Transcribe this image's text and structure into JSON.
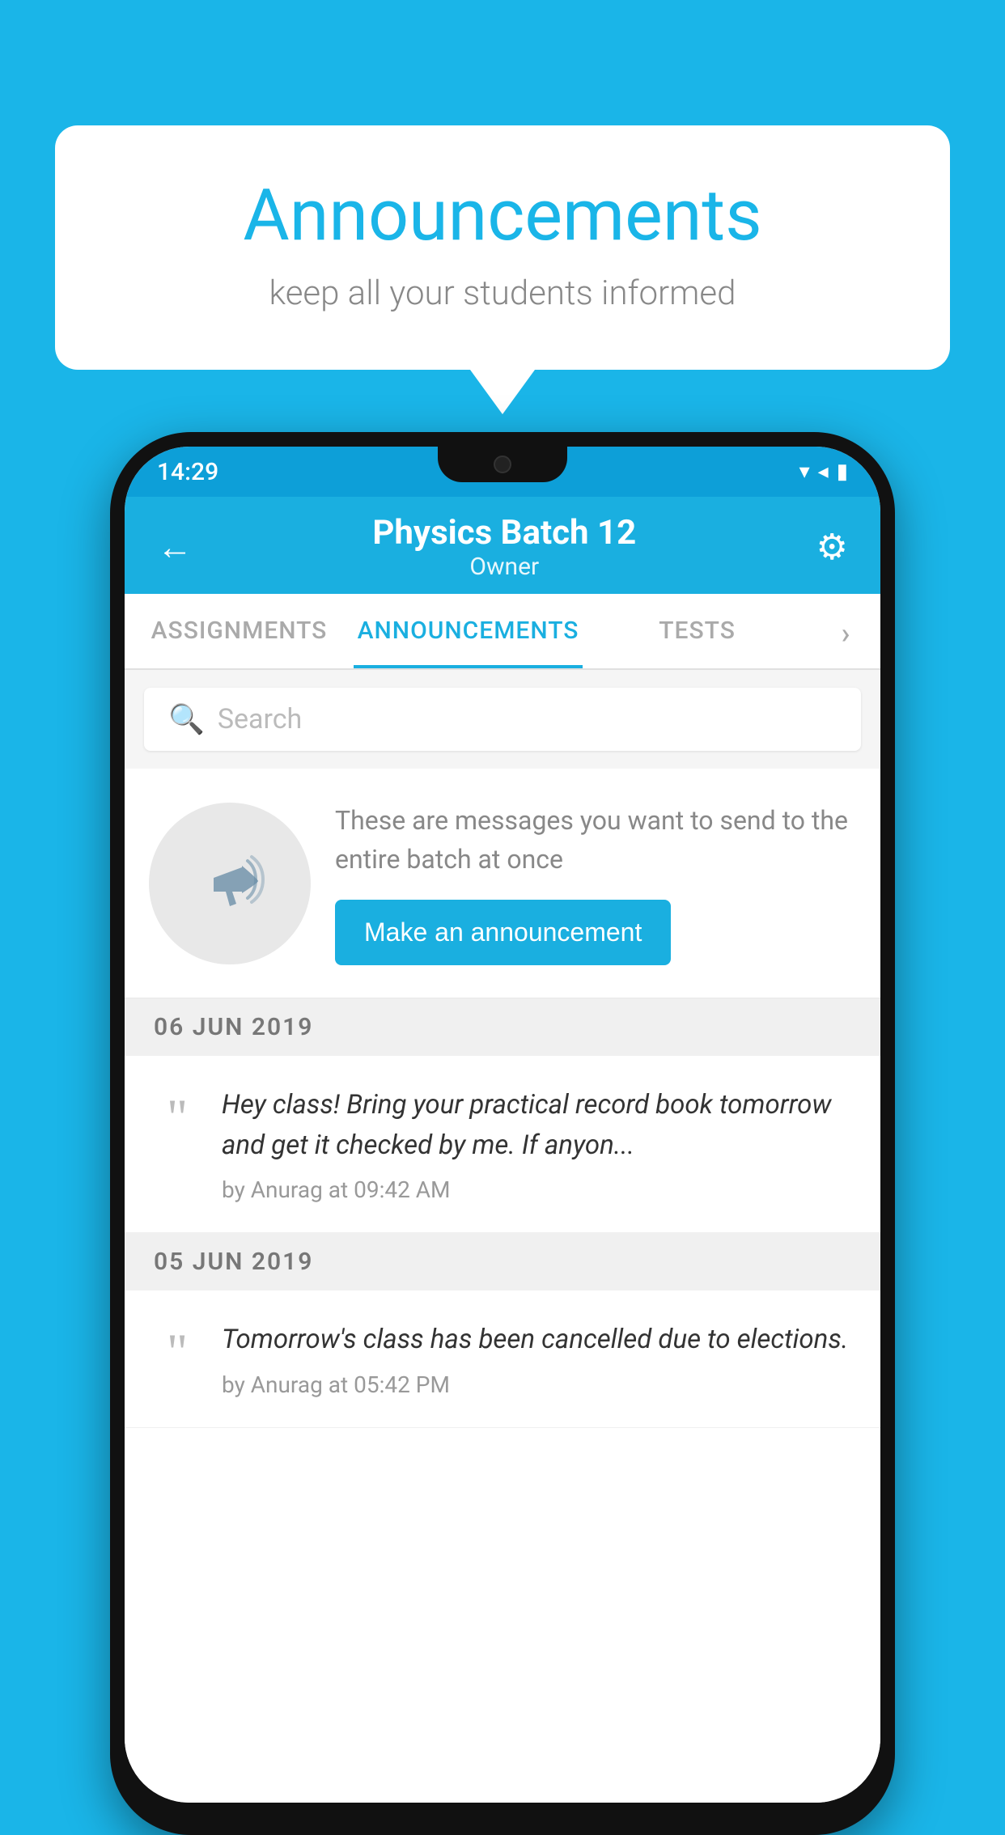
{
  "background_color": "#1ab5e8",
  "speech_bubble": {
    "title": "Announcements",
    "subtitle": "keep all your students informed"
  },
  "status_bar": {
    "time": "14:29",
    "wifi": "▼",
    "signal": "▲",
    "battery": "▮"
  },
  "header": {
    "back_label": "←",
    "title": "Physics Batch 12",
    "subtitle": "Owner",
    "settings_label": "⚙"
  },
  "tabs": [
    {
      "label": "ASSIGNMENTS",
      "active": false
    },
    {
      "label": "ANNOUNCEMENTS",
      "active": true
    },
    {
      "label": "TESTS",
      "active": false
    },
    {
      "label": "›",
      "active": false
    }
  ],
  "search": {
    "placeholder": "Search"
  },
  "empty_state": {
    "description": "These are messages you want to send to the entire batch at once",
    "button_label": "Make an announcement"
  },
  "announcements": [
    {
      "date": "06  JUN  2019",
      "message": "Hey class! Bring your practical record book tomorrow and get it checked by me. If anyon...",
      "author": "by Anurag at 09:42 AM"
    },
    {
      "date": "05  JUN  2019",
      "message": "Tomorrow's class has been cancelled due to elections.",
      "author": "by Anurag at 05:42 PM"
    }
  ]
}
